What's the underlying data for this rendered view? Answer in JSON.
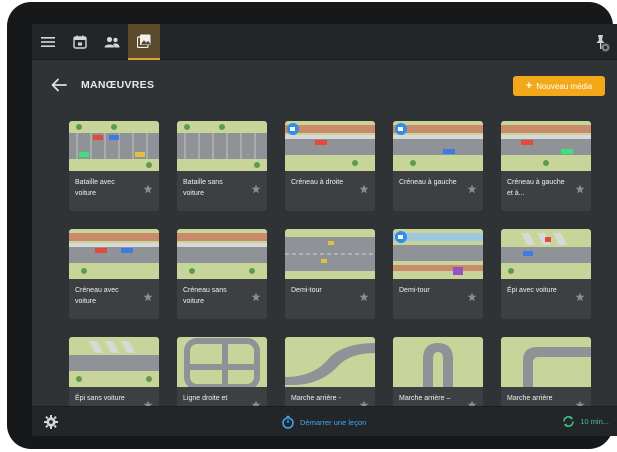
{
  "topbar": {
    "tabs": [
      {
        "name": "menu-icon"
      },
      {
        "name": "calendar-icon"
      },
      {
        "name": "users-icon"
      },
      {
        "name": "media-library-icon",
        "active": true
      }
    ],
    "pin_icon": "pin-icon"
  },
  "header": {
    "back_icon": "arrow-left-icon",
    "title": "MANŒUVRES",
    "new_button_label": "Nouveau média",
    "new_button_icon": "plus-icon"
  },
  "colors": {
    "accent": "#f3a81a",
    "screen_bg": "#2f3336",
    "card_bg": "#3c4043",
    "link_blue": "#3ea8f5",
    "sync_green": "#46c28a"
  },
  "media": [
    {
      "label": "Bataille avec voiture",
      "thumb": "parking-lot",
      "cars": true
    },
    {
      "label": "Bataille sans voiture",
      "thumb": "parking-lot",
      "cars": false
    },
    {
      "label": "Créneau à droite",
      "thumb": "parallel-park",
      "camera": true
    },
    {
      "label": "Créneau à gauche",
      "thumb": "parallel-park",
      "camera": true
    },
    {
      "label": "Créneau à gauche et à...",
      "thumb": "parallel-park",
      "camera": false
    },
    {
      "label": "Créneau avec voiture",
      "thumb": "parallel-park",
      "camera": false
    },
    {
      "label": "Créneau sans voiture",
      "thumb": "parallel-park",
      "camera": false
    },
    {
      "label": "Demi-tour",
      "thumb": "plain-road"
    },
    {
      "label": "Demi-tour",
      "thumb": "parallel-park",
      "camera": true
    },
    {
      "label": "Épi avec voiture",
      "thumb": "angle-park"
    },
    {
      "label": "Épi sans voiture",
      "thumb": "angle-park-2"
    },
    {
      "label": "Ligne droite et",
      "thumb": "track-loop"
    },
    {
      "label": "Marche arrière -",
      "thumb": "curve"
    },
    {
      "label": "Marche arrière –",
      "thumb": "u-turn"
    },
    {
      "label": "Marche arrière",
      "thumb": "corner"
    }
  ],
  "footer": {
    "settings_icon": "gear-icon",
    "lesson_icon": "stopwatch-icon",
    "lesson_label": "Démarrer une leçon",
    "sync_icon": "sync-icon",
    "sync_label": "10 min..."
  }
}
